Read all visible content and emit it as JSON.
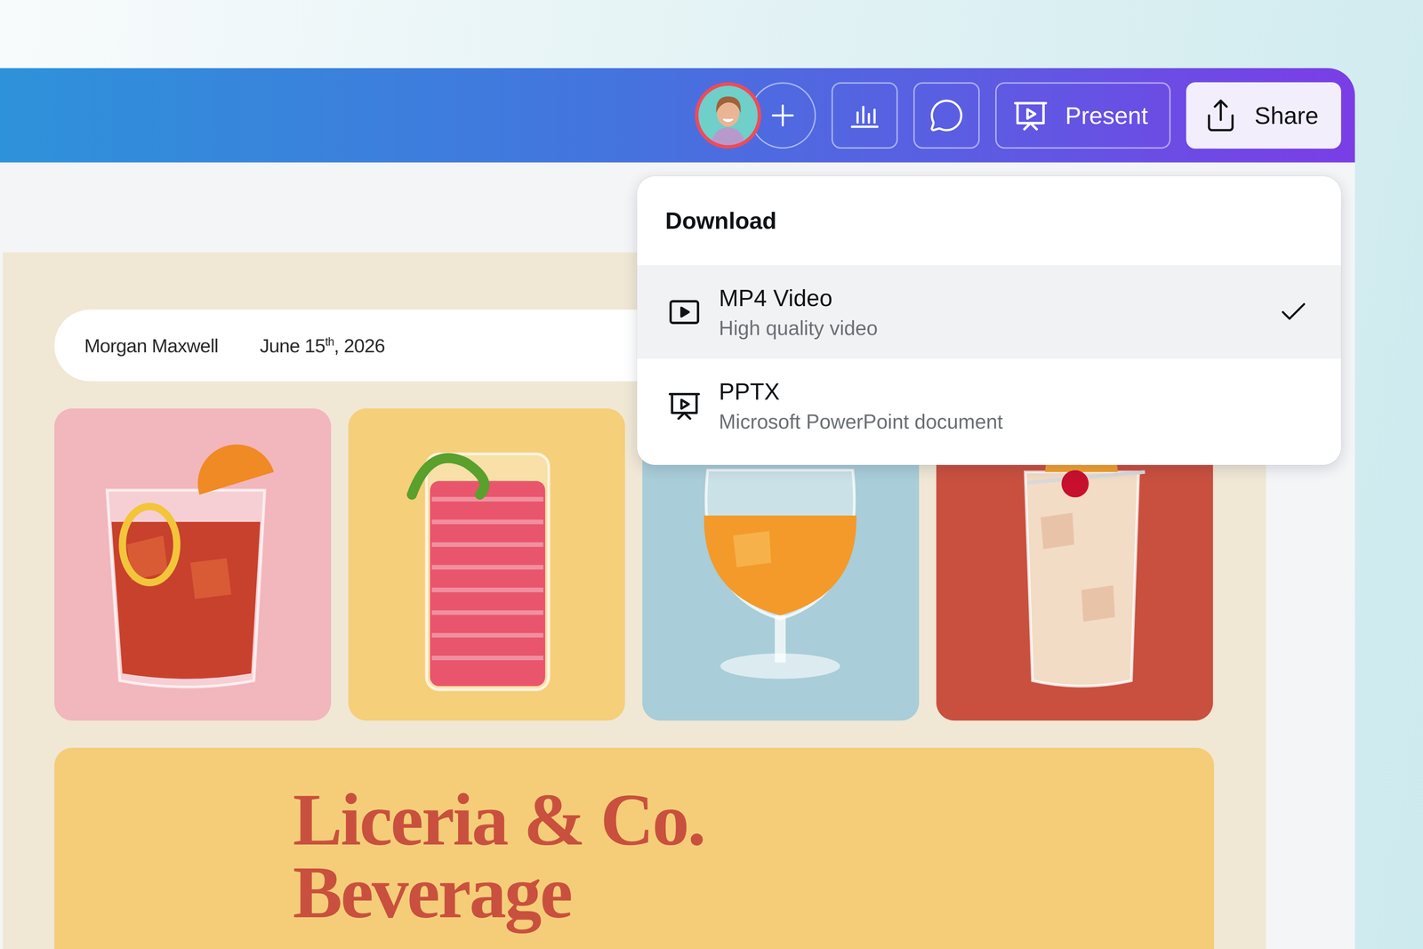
{
  "toolbar": {
    "present_button": {
      "label": "Present"
    },
    "share_button": {
      "label": "Share",
      "expanded": true
    }
  },
  "download_menu": {
    "title": "Download",
    "options": [
      {
        "label": "MP4 Video",
        "description": "High quality video",
        "kind": "video",
        "selected": true
      },
      {
        "label": "PPTX",
        "description": "Microsoft PowerPoint document",
        "kind": "presentation",
        "selected": false
      }
    ]
  },
  "design": {
    "info": {
      "author": "Morgan Maxwell",
      "date": "June 15",
      "date_suffix": "th",
      "year": ", 2026"
    },
    "cards": [
      {
        "kind": "rocks",
        "color": "#f2b6bd"
      },
      {
        "kind": "tall",
        "color": "#f5cf7a"
      },
      {
        "kind": "snifter",
        "color": "#a9cdd9"
      },
      {
        "kind": "highball",
        "color": "#c9503f"
      }
    ],
    "banner": {
      "title_lines": [
        "Liceria & Co.",
        "Beverage"
      ]
    }
  }
}
